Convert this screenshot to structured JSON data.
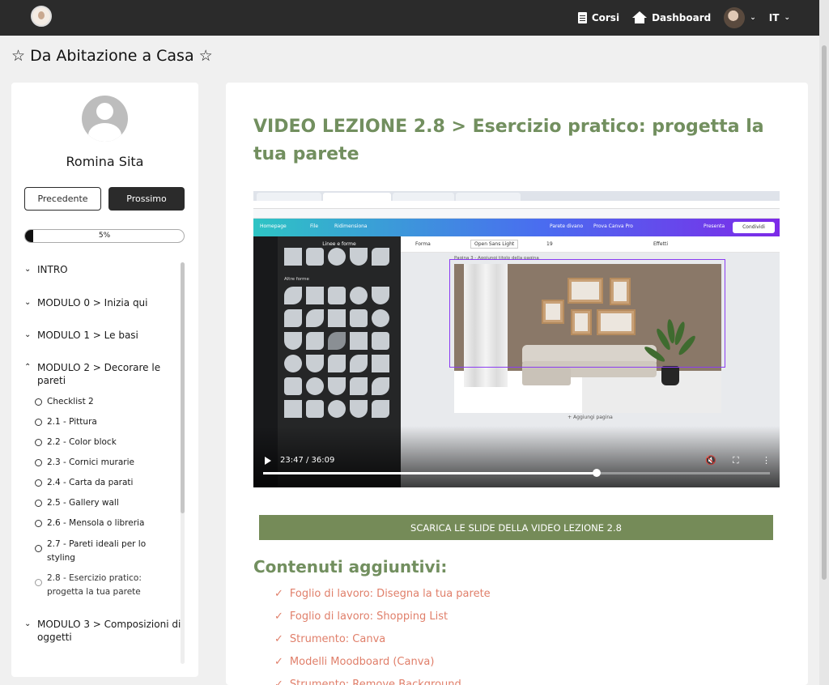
{
  "header": {
    "nav": [
      {
        "label": "Corsi",
        "icon": "document-icon"
      },
      {
        "label": "Dashboard",
        "icon": "home-icon"
      }
    ],
    "language": "IT"
  },
  "page": {
    "title": "☆ Da Abitazione a Casa ☆"
  },
  "sidebar": {
    "user_name": "Romina Sita",
    "prev_label": "Precedente",
    "next_label": "Prossimo",
    "progress_text": "5%",
    "progress_value": 0.05,
    "modules": [
      {
        "label": "INTRO",
        "state": "collapsed"
      },
      {
        "label": "MODULO 0 > Inizia qui",
        "state": "collapsed"
      },
      {
        "label": "MODULO 1 > Le basi",
        "state": "collapsed"
      },
      {
        "label": "MODULO 2 > Decorare le pareti",
        "state": "expanded"
      },
      {
        "label": "MODULO 3 > Composizioni di oggetti",
        "state": "collapsed"
      }
    ],
    "lessons": [
      "Checklist 2",
      "2.1 - Pittura",
      "2.2 - Color block",
      "2.3 - Cornici murarie",
      "2.4 - Carta da parati",
      "2.5 - Gallery wall",
      "2.6 - Mensola o libreria",
      "2.7 - Pareti ideali per lo styling",
      "2.8 - Esercizio pratico: progetta la tua parete"
    ]
  },
  "main": {
    "lesson_title": "VIDEO LEZIONE 2.8 > Esercizio pratico: progetta la tua parete",
    "video": {
      "current_time": "23:47",
      "duration": "36:09",
      "time_label": "23:47 / 36:09",
      "progress": 0.658,
      "screen": {
        "canva_home": "Homepage",
        "canva_file": "File",
        "canva_account": "Ridimensiona",
        "canva_doc": "Parete divano",
        "canva_pro": "Prova Canva Pro",
        "canva_present": "Presenta",
        "canva_share": "Condividi",
        "panel_title": "Linee e forme",
        "panel_section": "Altre forme",
        "toolbar_shape": "Forma",
        "toolbar_font": "Open Sans Light",
        "toolbar_size": "19",
        "toolbar_effects": "Effetti",
        "page_label": "Pagina 3 - Aggiungi titolo della pagina",
        "add_page": "+ Aggiungi pagina"
      }
    },
    "download_button": "SCARICA LE SLIDE DELLA VIDEO LEZIONE 2.8",
    "extra_heading": "Contenuti aggiuntivi:",
    "extra_items": [
      "Foglio di lavoro: Disegna la tua parete",
      "Foglio di lavoro: Shopping List",
      "Strumento: Canva",
      "Modelli Moodboard (Canva)",
      "Strumento: Remove Background"
    ]
  },
  "colors": {
    "topbar": "#2b2b2b",
    "accent_green": "#728f5f",
    "button_green": "#758b58",
    "link_coral": "#e07f6a"
  }
}
